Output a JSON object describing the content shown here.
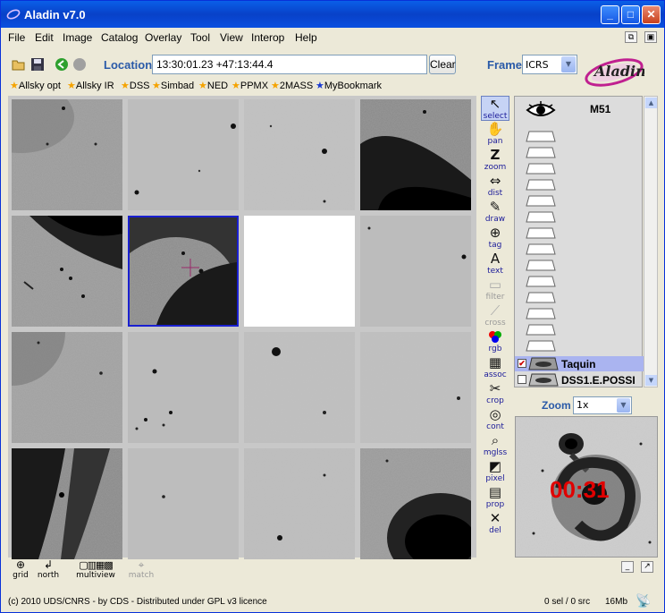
{
  "window": {
    "title": "Aladin v7.0",
    "minimize": "_",
    "maximize": "□",
    "close": "✕"
  },
  "menu": [
    "File",
    "Edit",
    "Image",
    "Catalog",
    "Overlay",
    "Tool",
    "View",
    "Interop",
    "Help"
  ],
  "toolbar": {
    "location_label": "Location",
    "location_value": "13:30:01.23 +47:13:44.4",
    "clear_label": "Clear",
    "frame_label": "Frame",
    "frame_value": "ICRS"
  },
  "bookmarks": [
    "Allsky opt",
    "Allsky IR",
    "DSS",
    "Simbad",
    "NED",
    "PPMX",
    "2MASS",
    "MyBookmark"
  ],
  "tools": [
    {
      "label": "select",
      "icon": "select-arrow-icon",
      "enabled": true
    },
    {
      "label": "pan",
      "icon": "hand-icon",
      "enabled": true
    },
    {
      "label": "zoom",
      "icon": "zoom-z-icon",
      "enabled": true
    },
    {
      "label": "dist",
      "icon": "distance-icon",
      "enabled": true
    },
    {
      "label": "draw",
      "icon": "pencil-icon",
      "enabled": true
    },
    {
      "label": "tag",
      "icon": "tag-icon",
      "enabled": true
    },
    {
      "label": "text",
      "icon": "text-icon",
      "enabled": true
    },
    {
      "label": "filter",
      "icon": "filter-icon",
      "enabled": false
    },
    {
      "label": "cross",
      "icon": "cross-icon",
      "enabled": false
    },
    {
      "label": "rgb",
      "icon": "rgb-icon",
      "enabled": true
    },
    {
      "label": "assoc",
      "icon": "film-icon",
      "enabled": true
    },
    {
      "label": "crop",
      "icon": "scissors-icon",
      "enabled": true
    },
    {
      "label": "cont",
      "icon": "contour-icon",
      "enabled": true
    },
    {
      "label": "mglss",
      "icon": "magnifier-icon",
      "enabled": true
    },
    {
      "label": "pixel",
      "icon": "pixel-icon",
      "enabled": true
    },
    {
      "label": "prop",
      "icon": "properties-icon",
      "enabled": true
    },
    {
      "label": "del",
      "icon": "delete-icon",
      "enabled": true
    }
  ],
  "stack": {
    "header": "M51",
    "planes": [
      {
        "name": "Taquin",
        "checked": true,
        "selected": true
      },
      {
        "name": "DSS1.E.POSSI",
        "checked": false,
        "selected": false
      }
    ]
  },
  "zoom": {
    "label": "Zoom",
    "value": "1x"
  },
  "timer": "00:31",
  "bottom_tools": [
    "grid",
    "north",
    "multiview",
    "match"
  ],
  "status": {
    "left": "(c) 2010 UDS/CNRS - by CDS - Distributed under GPL v3 licence",
    "selection": "0 sel / 0 src",
    "memory": "16Mb"
  }
}
